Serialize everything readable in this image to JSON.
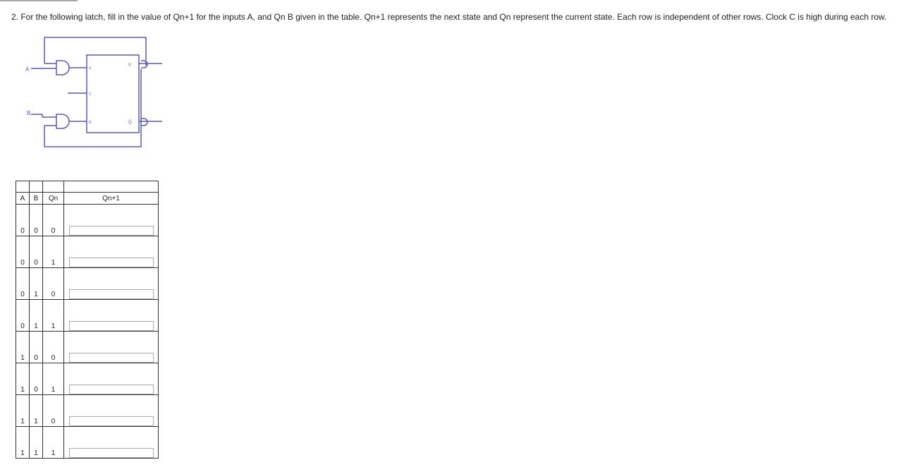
{
  "question": {
    "text": "2. For the following latch, fill in the value of Qn+1 for the inputs A, and Qn B given in the table. Qn+1 represents the next state and Qn represent the current state.  Each row is independent of other rows.  Clock C is high during each row."
  },
  "circuit": {
    "label_a": "A",
    "label_b": "B",
    "label_s": "S",
    "label_c": "C",
    "label_r": "R",
    "label_q": "Q",
    "label_qbar": "Q̄",
    "wire_color": "#5a5ab8"
  },
  "table": {
    "headers": [
      "A",
      "B",
      "Qn",
      "Qn+1"
    ],
    "rows": [
      {
        "a": "0",
        "b": "0",
        "qn": "0"
      },
      {
        "a": "0",
        "b": "0",
        "qn": "1"
      },
      {
        "a": "0",
        "b": "1",
        "qn": "0"
      },
      {
        "a": "0",
        "b": "1",
        "qn": "1"
      },
      {
        "a": "1",
        "b": "0",
        "qn": "0"
      },
      {
        "a": "1",
        "b": "0",
        "qn": "1"
      },
      {
        "a": "1",
        "b": "1",
        "qn": "0"
      },
      {
        "a": "1",
        "b": "1",
        "qn": "1"
      }
    ]
  }
}
